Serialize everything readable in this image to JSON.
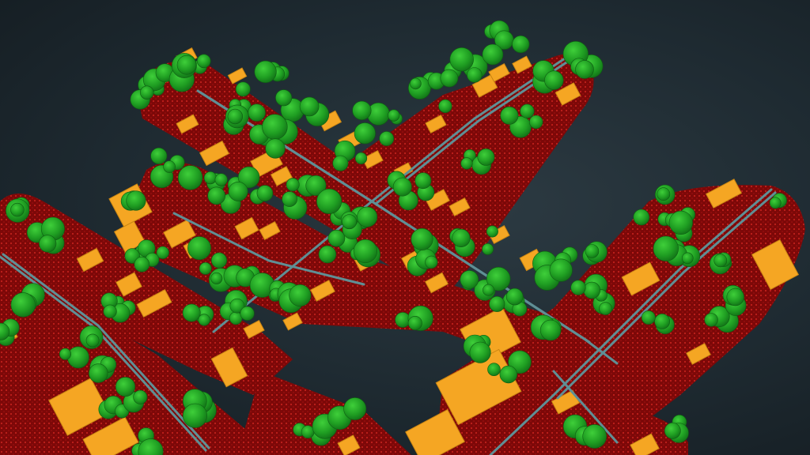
{
  "scene": {
    "description_label": "",
    "legend": [],
    "colors": {
      "background": "#1e2a31",
      "ground": "#8a0a0a",
      "ground_dots": "#b81818",
      "vegetation": "#1f9e22",
      "vegetation_light": "#2fc032",
      "buildings": "#f5a623",
      "building_edge": "#c98512",
      "wires": "#5f8f95"
    }
  }
}
